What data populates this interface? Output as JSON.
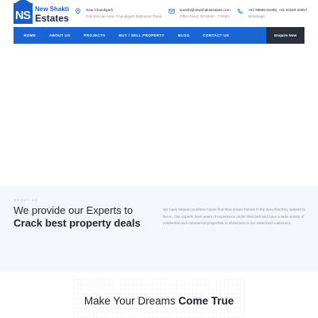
{
  "brand": {
    "mark": "NS",
    "line1": "New Shakti",
    "line2": "Estates",
    "color": "#1a5fc8"
  },
  "contact": {
    "location": {
      "icon": "location-pin-icon",
      "title": "New Chandigarh",
      "subtitle": "Commercial Area, Chandigarh Mullanpur Road"
    },
    "email": {
      "icon": "mail-icon",
      "title": "suresh@newshaktiestates.com",
      "subtitle": "Office Hour: 09:00am - 7:00pm"
    },
    "phone": {
      "icon": "phone-icon",
      "title": "+91 99889 81688, +91 93160 02857",
      "subtitle": "Whatsapp"
    }
  },
  "nav": {
    "items": [
      "HOME",
      "ABOUT US",
      "PROJECTS",
      "BUY / SELL PROPERTY",
      "BLOG",
      "CONTACT US"
    ],
    "cta": "Enquire Now",
    "color": "#1b64d4"
  },
  "about": {
    "kicker": "ABOUT US",
    "heading_line1": "We provide our Experts to",
    "heading_line2": "Crack best property deals",
    "paragraph": "We have helped countless hopes find their dream homes in the area that they wanted to live in. Our experts have years of experience under their belt and have a wide variety of residential and commercial properties to showcase to our esteemed customers."
  },
  "dreams": {
    "title_regular": "Make Your Dreams ",
    "title_bold": "Come True"
  }
}
